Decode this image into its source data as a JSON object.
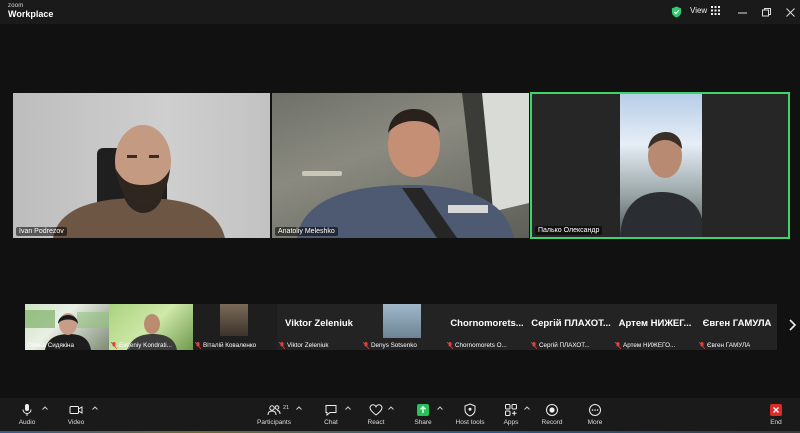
{
  "app": {
    "brand_top": "zoom",
    "brand_bottom": "Workplace",
    "view_label": "View"
  },
  "colors": {
    "active_speaker": "#3fd36b",
    "end_button": "#e02828",
    "share_button": "#25c25a",
    "shield": "#2ecc71"
  },
  "stage": {
    "tiles": [
      {
        "name": "Ivan Podrezov"
      },
      {
        "name": "Anatoliy Meleshko"
      },
      {
        "name": "Палько Олександр",
        "active": true
      }
    ]
  },
  "strip": {
    "thumbs": [
      {
        "name": "Олена Сидякіна",
        "muted": false
      },
      {
        "name": "Evgeniy Kondrati...",
        "muted": true
      },
      {
        "name": "Віталій Коваленко",
        "muted": true
      },
      {
        "big": "Viktor Zeleniuk",
        "name": "Viktor Zeleniuk",
        "muted": true
      },
      {
        "name": "Denys Sotsenko",
        "muted": true
      },
      {
        "big": "Chornomorets...",
        "name": "Chornomorets O...",
        "muted": true
      },
      {
        "big": "Сергій  ПЛАХОТ...",
        "name": "Сергій ПЛАХОТ...",
        "muted": true
      },
      {
        "big": "Артем  НИЖЕГ...",
        "name": "Артем НИЖЕГО...",
        "muted": true
      },
      {
        "big": "Євген ГАМУЛА",
        "name": "Євген ГАМУЛА",
        "muted": true
      }
    ]
  },
  "toolbar": {
    "audio": "Audio",
    "video": "Video",
    "participants": "Participants",
    "participants_count": "21",
    "chat": "Chat",
    "react": "React",
    "share": "Share",
    "host_tools": "Host tools",
    "apps": "Apps",
    "record": "Record",
    "more": "More",
    "end": "End"
  }
}
